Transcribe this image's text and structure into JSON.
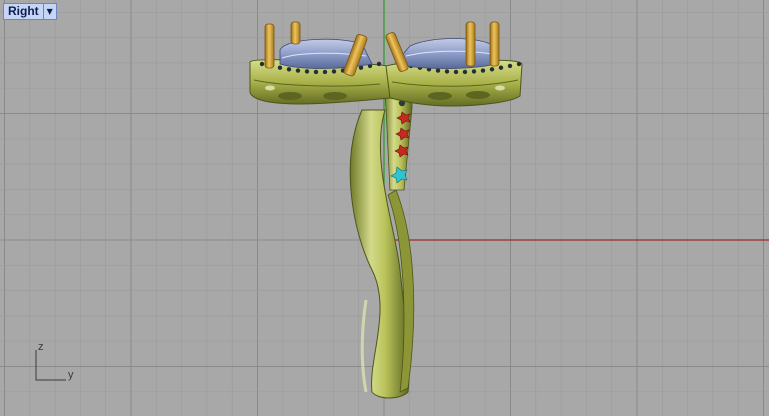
{
  "viewport": {
    "name": "Right",
    "menu_icon": "dropdown-arrow-icon"
  },
  "axis_widget": {
    "vertical_label": "z",
    "horizontal_label": "y"
  },
  "colors": {
    "background": "#a8a8a8",
    "grid_minor": "#9c9c9c",
    "grid_major": "#8a8a8a",
    "axis_x_red": "#9c2a2a",
    "axis_z_green": "#2a9a2a",
    "metal": "#b9c25a",
    "prong_gold": "#d9a83a",
    "gem_blue": "#8e9ec9",
    "accent_red": "#c42a20",
    "accent_cyan": "#2fc4d0"
  }
}
